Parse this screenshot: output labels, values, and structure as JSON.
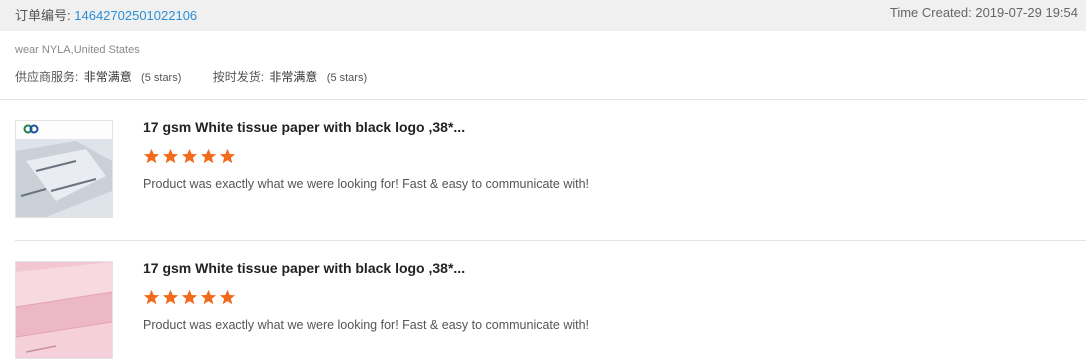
{
  "order": {
    "label": "订单编号:",
    "number": "14642702501022106",
    "time_created": "Time Created: 2019-07-29 19:54"
  },
  "buyer": {
    "name_location": "wear NYLA,United States"
  },
  "seller_ratings": [
    {
      "label": "供应商服务:",
      "value": "非常满意",
      "stars_text": "(5 stars)"
    },
    {
      "label": "按时发货:",
      "value": "非常满意",
      "stars_text": "(5 stars)"
    }
  ],
  "reviews": [
    {
      "product_title": "17 gsm White tissue paper with black logo ,38*...",
      "rating": 5,
      "comment": "Product was exactly what we were looking for! Fast & easy to communicate with!",
      "thumbnail": "white-tissue-paper-photo"
    },
    {
      "product_title": "17 gsm White tissue paper with black logo ,38*...",
      "rating": 5,
      "comment": "Product was exactly what we were looking for! Fast & easy to communicate with!",
      "thumbnail": "pink-tissue-paper-photo"
    }
  ],
  "colors": {
    "link_blue": "#2a8fd8",
    "star_orange": "#f26b1c",
    "header_bg": "#f0f0f0"
  }
}
